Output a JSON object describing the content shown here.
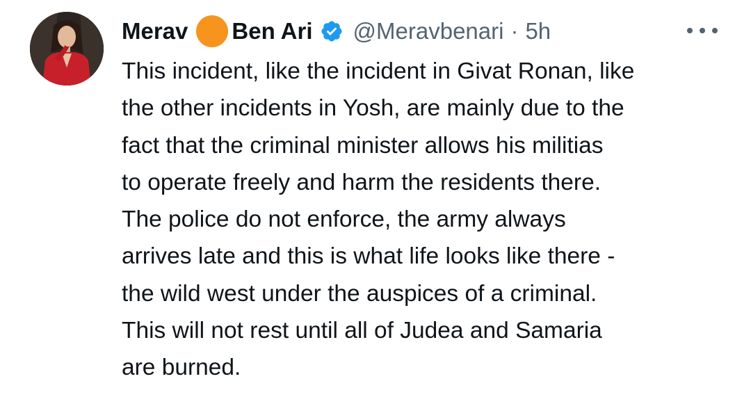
{
  "tweet": {
    "name_first": "Merav",
    "name_last": "Ben Ari",
    "handle": "@Meravbenari",
    "separator": "·",
    "time": "5h",
    "body_lines": [
      "This incident, like the incident in Givat Ronan, like",
      "the other incidents in Yosh, are mainly due to the",
      "fact that the criminal minister allows his militias",
      "to operate freely and harm the residents there.",
      "The police do not enforce, the army always",
      "arrives late and this is what life looks like there -",
      "the wild west under the auspices of a criminal.",
      "This will not rest until all of Judea and Samaria",
      "are burned."
    ]
  },
  "icons": {
    "name_emoji": "orange-circle-icon",
    "verified": "verified-badge-icon",
    "more": "more-options-icon"
  },
  "colors": {
    "text_primary": "#0f1419",
    "text_secondary": "#536471",
    "verified_blue": "#1d9bf0",
    "emoji_orange": "#f7941d",
    "jacket_red": "#c8202a"
  }
}
